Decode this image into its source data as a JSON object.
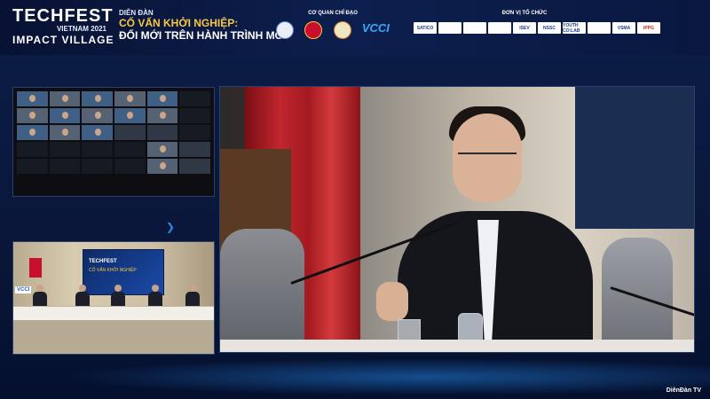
{
  "header": {
    "brand_line1": "TECHFEST",
    "brand_line2": "VIETNAM 2021",
    "brand_line3": "IMPACT VILLAGE",
    "forum_label": "DIỄN ĐÀN",
    "forum_title_a": "CỐ VẤN KHỞI NGHIỆP:",
    "forum_title_b": "ĐỔI MỚI TRÊN HÀNH TRÌNH MỚI",
    "guidance_label": "CƠ QUAN CHỈ ĐẠO",
    "vcci": "VCCI",
    "organizers_label": "ĐƠN VỊ TỔ CHỨC",
    "organizers": [
      "SATICO",
      "",
      "",
      "",
      "ISEV",
      "NSSC",
      "YOUTH CO:LAB",
      "",
      "VSMA",
      "IPPG"
    ]
  },
  "room": {
    "screen_title": "TECHFEST",
    "screen_sub": "CỐ VẤN KHỞI NGHIỆP",
    "vcci_tag": "VCCI"
  },
  "footer": {
    "watermark": "DiênĐàn TV"
  },
  "colors": {
    "accent": "#19c2e6",
    "highlight": "#f6c744",
    "brand_red": "#c8102e"
  }
}
